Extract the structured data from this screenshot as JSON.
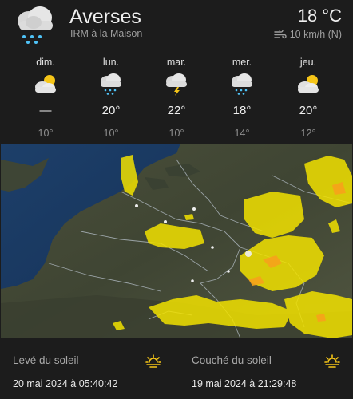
{
  "header": {
    "condition": "Averses",
    "station": "IRM à la Maison",
    "temperature": "18 °C",
    "wind": "10 km/h (N)",
    "icon": "rain-cloud-icon"
  },
  "forecast": [
    {
      "day": "dim.",
      "icon": "partly-cloudy-icon",
      "high": "—",
      "low": "10°"
    },
    {
      "day": "lun.",
      "icon": "rain-cloud-icon",
      "high": "20°",
      "low": "10°"
    },
    {
      "day": "mar.",
      "icon": "thunder-cloud-icon",
      "high": "22°",
      "low": "10°"
    },
    {
      "day": "mer.",
      "icon": "rain-cloud-icon",
      "high": "18°",
      "low": "14°"
    },
    {
      "day": "jeu.",
      "icon": "partly-cloudy-icon",
      "high": "20°",
      "low": "12°"
    }
  ],
  "sun": {
    "sunrise_label": "Levé du soleil",
    "sunrise_value": "20 mai 2024 à 05:40:42",
    "sunset_label": "Couché du soleil",
    "sunset_value": "19 mai 2024 à 21:29:48"
  },
  "colors": {
    "background": "#1c1c1c",
    "accent_sun": "#f5c518",
    "rain_drop": "#4fc3f7",
    "radar_precip": "#f2e200"
  }
}
